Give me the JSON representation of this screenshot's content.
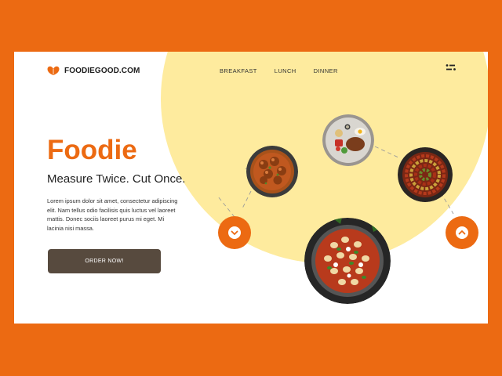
{
  "brand": {
    "name": "FOODIEGOOD.COM",
    "logo_icon": "leaf-heart-icon"
  },
  "nav": {
    "items": [
      {
        "label": "BREAKFAST"
      },
      {
        "label": "LUNCH"
      },
      {
        "label": "DINNER"
      }
    ]
  },
  "menu_icon": "menu-icon",
  "hero": {
    "title": "Foodie",
    "tagline": "Measure Twice. Cut Once.",
    "description": "Lorem ipsum dolor sit amet, consectetur adipiscing elit. Nam tellus odio facilisis quis luctus vel laoreet mattis. Donec sociis laoreet purus mi eget. Mi lacinia nisi massa.",
    "cta_label": "ORDER NOW!"
  },
  "carousel": {
    "prev_icon": "chevron-down-icon",
    "next_icon": "chevron-up-icon",
    "dishes": [
      {
        "name": "meatball-curry-dish"
      },
      {
        "name": "breakfast-plate-dish"
      },
      {
        "name": "ratatouille-dish"
      },
      {
        "name": "tomato-gnocchi-dish"
      }
    ]
  },
  "colors": {
    "accent": "#EC6A12",
    "highlight": "#FEEB9E",
    "button": "#574A3E",
    "text": "#1D1D1D"
  }
}
